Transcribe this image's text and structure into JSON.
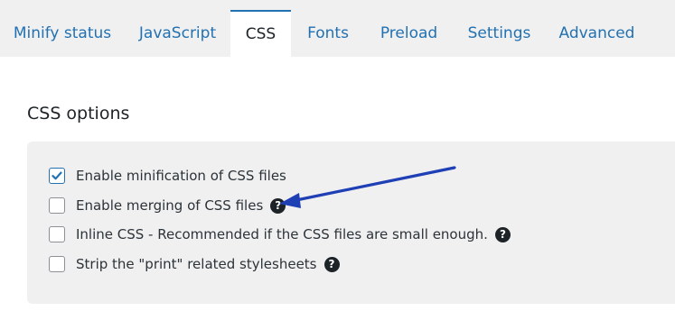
{
  "tabs": [
    {
      "label": "Minify status",
      "active": false
    },
    {
      "label": "JavaScript",
      "active": false
    },
    {
      "label": "CSS",
      "active": true
    },
    {
      "label": "Fonts",
      "active": false
    },
    {
      "label": "Preload",
      "active": false
    },
    {
      "label": "Settings",
      "active": false
    },
    {
      "label": "Advanced",
      "active": false
    }
  ],
  "section": {
    "title": "CSS options",
    "options": [
      {
        "label": "Enable minification of CSS files",
        "checked": true,
        "has_help": false
      },
      {
        "label": "Enable merging of CSS files",
        "checked": false,
        "has_help": true
      },
      {
        "label": "Inline CSS - Recommended if the CSS files are small enough.",
        "checked": false,
        "has_help": true
      },
      {
        "label": "Strip the \"print\" related stylesheets",
        "checked": false,
        "has_help": true
      }
    ]
  },
  "help_icon_glyph": "?",
  "colors": {
    "accent": "#2271b1",
    "annotation_arrow": "#1f3fb5",
    "tab_bar": "#f0f0f1",
    "panel": "#f0f0f1"
  }
}
